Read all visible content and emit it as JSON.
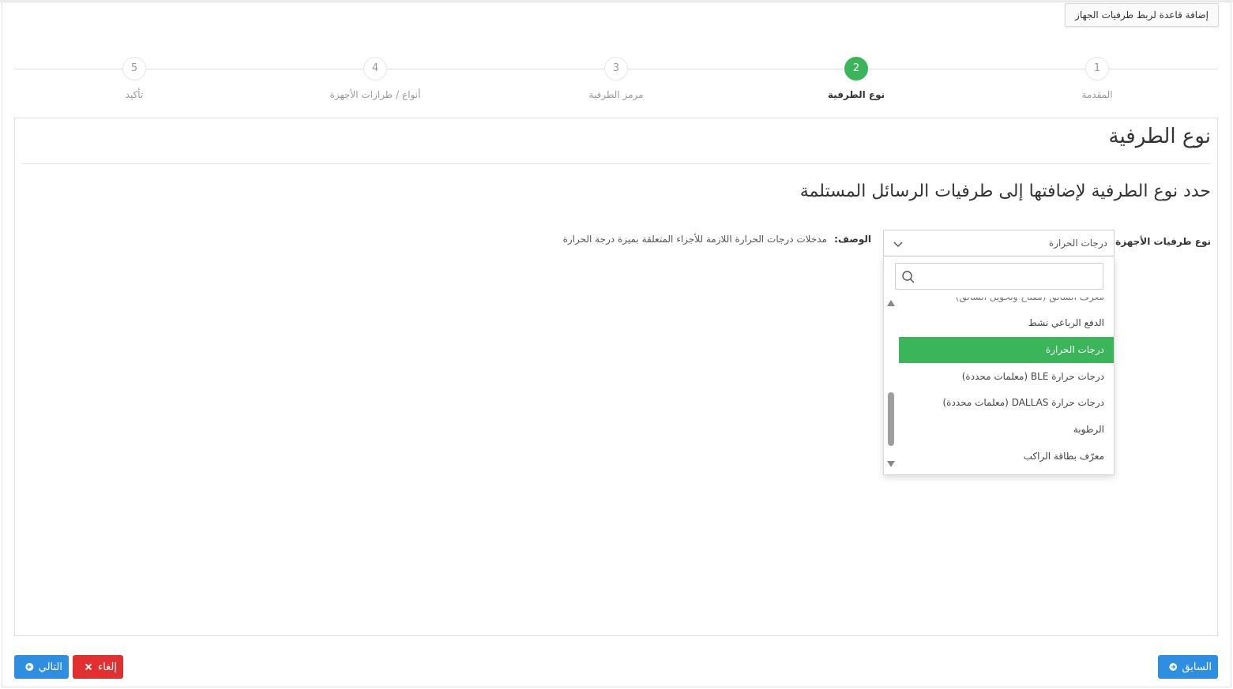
{
  "window": {
    "title": "إضافة قاعدة لربط طرفيات الجهاز"
  },
  "steps": [
    {
      "number": "1",
      "label": "المقدمة",
      "active": false
    },
    {
      "number": "2",
      "label": "نوع الطرفية",
      "active": true
    },
    {
      "number": "3",
      "label": "مرمز الطرفية",
      "active": false
    },
    {
      "number": "4",
      "label": "أنواع / طرازات الأجهزة",
      "active": false
    },
    {
      "number": "5",
      "label": "تأكيد",
      "active": false
    }
  ],
  "panel": {
    "title": "نوع الطرفية",
    "subtitle": "حدد نوع الطرفية لإضافتها إلى طرفيات الرسائل المستلمة",
    "field_label": "نوع طرفيات الأجهزة:",
    "selected_value": "درجات الحرارة",
    "description_label": "الوصف:",
    "description_text": "مدخلات درجات الحرارة اللازمة للأجزاء المتعلقة بميزة درجة الحرارة"
  },
  "dropdown": {
    "search_placeholder": "",
    "options": [
      {
        "label": "معرّف السائق (مفتاح وتحويل السائق)",
        "state": "partial"
      },
      {
        "label": "الدفع الرباعي نشط",
        "state": "normal"
      },
      {
        "label": "درجات الحرارة",
        "state": "selected"
      },
      {
        "label": "درجات حرارة BLE (معلمات محددة)",
        "state": "normal"
      },
      {
        "label": "درجات حرارة DALLAS (معلمات محددة)",
        "state": "normal"
      },
      {
        "label": "الرطوبة",
        "state": "normal"
      },
      {
        "label": "معرّف بطاقة الراكب",
        "state": "normal"
      }
    ]
  },
  "footer": {
    "prev_label": "السابق",
    "next_label": "التالي",
    "cancel_label": "إلغاء"
  },
  "colors": {
    "accent_green": "#3bb55a",
    "button_blue": "#2e8fe0",
    "button_red": "#e03030"
  }
}
